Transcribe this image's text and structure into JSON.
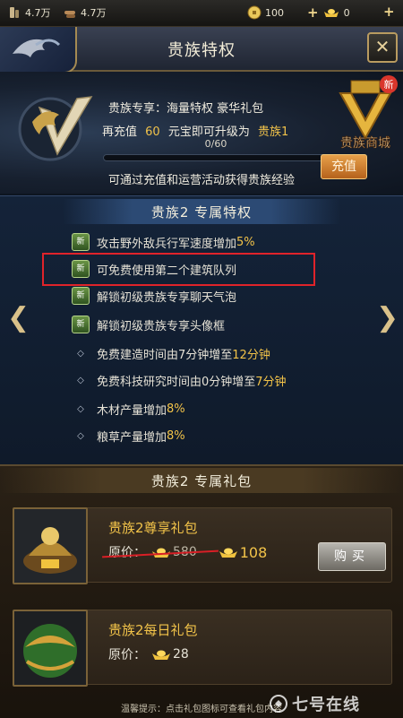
{
  "topbar": {
    "food_amount": "4.7万",
    "wood_amount": "4.7万",
    "coins": "100",
    "gold": "0"
  },
  "header": {
    "title": "贵族特权"
  },
  "vip": {
    "line1_prefix": "贵族专享：",
    "line1_items": "海量特权  豪华礼包",
    "line2_prefix": "再充值",
    "line2_amount": "60",
    "line2_mid": "元宝即可升级为",
    "line2_level": "贵族1",
    "progress_text": "0/60",
    "progress": 0,
    "hint": "可通过充值和运营活动获得贵族经验",
    "recharge_label": "充值",
    "store_label": "贵族商城",
    "store_badge": "新"
  },
  "privileges": {
    "title": "贵族2  专属特权",
    "new_badge": "新",
    "items": [
      {
        "text": "攻击野外敌兵行军速度增加",
        "highlight": "5%",
        "is_new": true
      },
      {
        "text": "可免费使用第二个建筑队列",
        "highlight": "",
        "is_new": true
      },
      {
        "text": "解锁初级贵族专享聊天气泡",
        "highlight": "",
        "is_new": true
      },
      {
        "text": "解锁初级贵族专享头像框",
        "highlight": "",
        "is_new": true
      },
      {
        "text": "免费建造时间由7分钟增至",
        "highlight": "12分钟",
        "is_new": false
      },
      {
        "text": "免费科技研究时间由0分钟增至",
        "highlight": "7分钟",
        "is_new": false
      },
      {
        "text": "木材产量增加",
        "highlight": "8%",
        "is_new": false
      },
      {
        "text": "粮草产量增加",
        "highlight": "8%",
        "is_new": false
      }
    ]
  },
  "gifts": {
    "title": "贵族2  专属礼包",
    "items": [
      {
        "name": "贵族2尊享礼包",
        "price_label": "原价：",
        "original_price": "580",
        "price": "108",
        "buy_label": "购买"
      },
      {
        "name": "贵族2每日礼包",
        "price_label": "原价：",
        "price": "28"
      }
    ],
    "footer_tip": "温馨提示：点击礼包图标可查看礼包内容"
  },
  "watermark": "七号在线",
  "colors": {
    "accent_gold": "#f2c349",
    "highlight_box": "#e0232a",
    "new_badge_green": "#4f7a34"
  }
}
